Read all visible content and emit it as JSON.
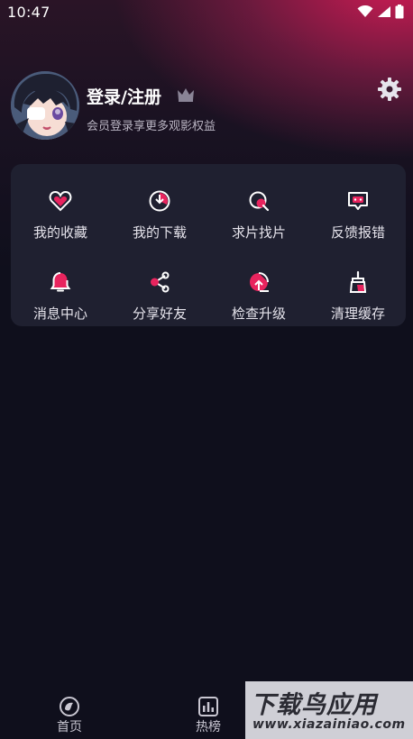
{
  "status_bar": {
    "time": "10:47"
  },
  "profile": {
    "title": "登录/注册",
    "subtitle": "会员登录享更多观影权益"
  },
  "grid": {
    "items": [
      {
        "label": "我的收藏",
        "icon": "heart-icon"
      },
      {
        "label": "我的下载",
        "icon": "download-pie-icon"
      },
      {
        "label": "求片找片",
        "icon": "search-film-icon"
      },
      {
        "label": "反馈报错",
        "icon": "feedback-chat-icon"
      },
      {
        "label": "消息中心",
        "icon": "bell-icon"
      },
      {
        "label": "分享好友",
        "icon": "share-icon"
      },
      {
        "label": "检查升级",
        "icon": "upgrade-icon"
      },
      {
        "label": "清理缓存",
        "icon": "broom-icon"
      }
    ]
  },
  "bottom_nav": {
    "items": [
      {
        "label": "首页",
        "icon": "home-icon"
      },
      {
        "label": "热榜",
        "icon": "chart-icon"
      }
    ]
  },
  "watermark": {
    "title": "下载鸟应用",
    "url": "www.xiazainiao.com"
  },
  "colors": {
    "accent": "#e8245e",
    "background": "#0f0f1c",
    "card": "#1f2030"
  }
}
